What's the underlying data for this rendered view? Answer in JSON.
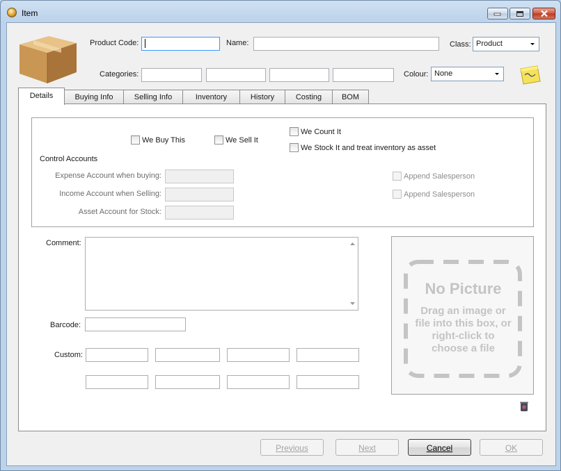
{
  "window": {
    "title": "Item"
  },
  "header": {
    "product_code_label": "Product Code:",
    "product_code_value": "",
    "name_label": "Name:",
    "name_value": "",
    "class_label": "Class:",
    "class_value": "Product",
    "categories_label": "Categories:",
    "categories": [
      "",
      "",
      "",
      ""
    ],
    "colour_label": "Colour:",
    "colour_value": "None"
  },
  "tabs": [
    {
      "label": "Details",
      "active": true
    },
    {
      "label": "Buying Info"
    },
    {
      "label": "Selling Info"
    },
    {
      "label": "Inventory"
    },
    {
      "label": "History"
    },
    {
      "label": "Costing"
    },
    {
      "label": "BOM"
    }
  ],
  "details": {
    "we_buy_this": "We Buy This",
    "we_sell_it": "We Sell It",
    "we_count_it": "We Count It",
    "we_stock_it": "We Stock It and treat inventory as asset",
    "control_accounts_label": "Control Accounts",
    "expense_account_label": "Expense Account when buying:",
    "income_account_label": "Income Account when Selling:",
    "asset_account_label": "Asset Account for Stock:",
    "append_salesperson_1": "Append Salesperson",
    "append_salesperson_2": "Append Salesperson",
    "comment_label": "Comment:",
    "barcode_label": "Barcode:",
    "custom_label": "Custom:",
    "picture_title": "No Picture",
    "picture_hint": "Drag an image or file into this box, or right-click to choose a file"
  },
  "buttons": {
    "previous": "Previous",
    "next": "Next",
    "cancel": "Cancel",
    "ok": "OK"
  }
}
